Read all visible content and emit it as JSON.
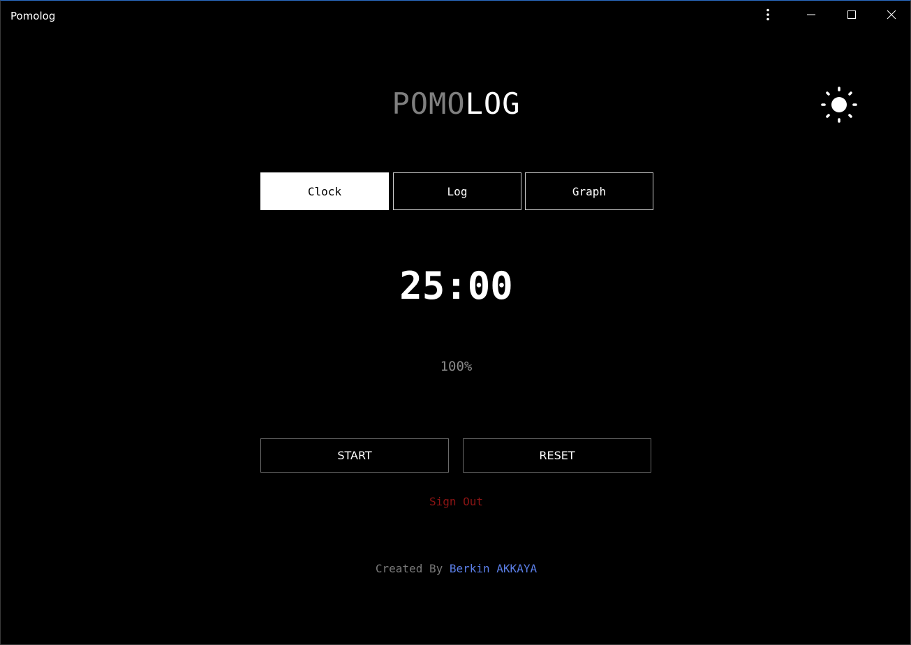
{
  "window": {
    "title": "Pomolog",
    "controls": {
      "more": "more-vertical-icon",
      "minimize": "minimize-icon",
      "maximize": "maximize-icon",
      "close": "close-icon"
    }
  },
  "logo": {
    "part1": "POMO",
    "part2": "LOG"
  },
  "theme_toggle": {
    "icon": "sun-icon"
  },
  "tabs": [
    {
      "label": "Clock",
      "active": true
    },
    {
      "label": "Log",
      "active": false
    },
    {
      "label": "Graph",
      "active": false
    }
  ],
  "timer": {
    "display": "25:00",
    "percent": "100%"
  },
  "actions": {
    "start_label": "START",
    "reset_label": "RESET"
  },
  "sign_out": "Sign Out",
  "footer": {
    "prefix": "Created By",
    "author": "Berkin AKKAYA"
  },
  "colors": {
    "background": "#000000",
    "logo_dim": "#7f7f7f",
    "sign_out": "#8b1414",
    "author_link": "#5b7fe8",
    "window_accent": "#2b6cc4"
  }
}
